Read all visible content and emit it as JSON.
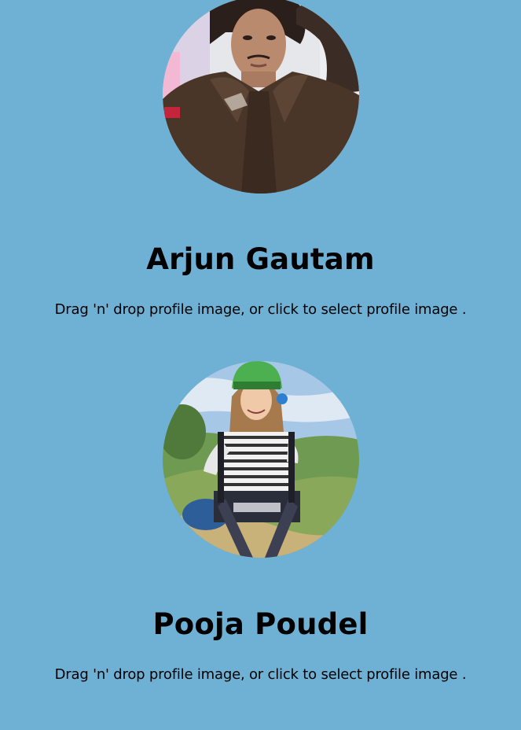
{
  "profiles": [
    {
      "name": "Arjun Gautam",
      "hint": "Drag 'n' drop profile image, or click to select profile image ."
    },
    {
      "name": "Pooja Poudel",
      "hint": "Drag 'n' drop profile image, or click to select profile image ."
    }
  ],
  "colors": {
    "background": "#6fb1d5",
    "text": "#000000"
  }
}
